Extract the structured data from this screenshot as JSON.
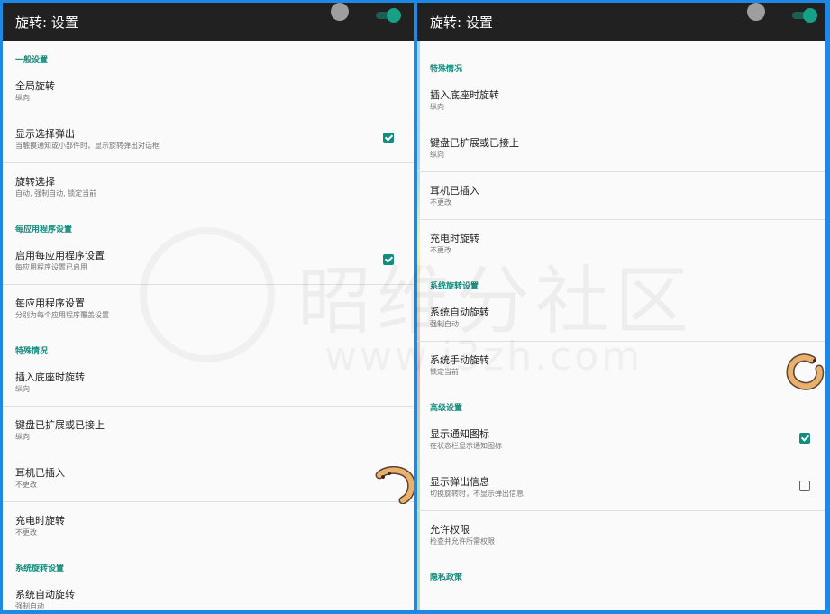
{
  "app": {
    "title": "旋转: 设置"
  },
  "left": {
    "sections": [
      {
        "header": "一般设置",
        "items": [
          {
            "title": "全局旋转",
            "subtitle": "纵向"
          },
          {
            "title": "显示选择弹出",
            "subtitle": "当触摸通知或小部件时，显示旋转弹出对话框",
            "checked": true
          },
          {
            "title": "旋转选择",
            "subtitle": "自动, 强制自动, 锁定当前"
          }
        ]
      },
      {
        "header": "每应用程序设置",
        "items": [
          {
            "title": "启用每应用程序设置",
            "subtitle": "每应用程序设置已启用",
            "checked": true
          },
          {
            "title": "每应用程序设置",
            "subtitle": "分别为每个应用程序覆盖设置"
          }
        ]
      },
      {
        "header": "特殊情况",
        "items": [
          {
            "title": "插入底座时旋转",
            "subtitle": "纵向"
          },
          {
            "title": "键盘已扩展或已接上",
            "subtitle": "纵向"
          },
          {
            "title": "耳机已插入",
            "subtitle": "不更改"
          },
          {
            "title": "充电时旋转",
            "subtitle": "不更改"
          }
        ]
      },
      {
        "header": "系统旋转设置",
        "items": [
          {
            "title": "系统自动旋转",
            "subtitle": "强制自动"
          }
        ]
      }
    ]
  },
  "right": {
    "partial_top": {
      "title": "每应用程序设置",
      "subtitle": "分别为每个应用程序覆盖设置"
    },
    "sections": [
      {
        "header": "特殊情况",
        "items": [
          {
            "title": "插入底座时旋转",
            "subtitle": "纵向"
          },
          {
            "title": "键盘已扩展或已接上",
            "subtitle": "纵向"
          },
          {
            "title": "耳机已插入",
            "subtitle": "不更改"
          },
          {
            "title": "充电时旋转",
            "subtitle": "不更改"
          }
        ]
      },
      {
        "header": "系统旋转设置",
        "items": [
          {
            "title": "系统自动旋转",
            "subtitle": "强制自动"
          },
          {
            "title": "系统手动旋转",
            "subtitle": "锁定当前"
          }
        ]
      },
      {
        "header": "高级设置",
        "items": [
          {
            "title": "显示通知图标",
            "subtitle": "在状态栏显示通知图标",
            "checked": true
          },
          {
            "title": "显示弹出信息",
            "subtitle": "切换旋转时，不显示弹出信息",
            "checked": false
          },
          {
            "title": "允许权限",
            "subtitle": "检查并允许所需权限"
          }
        ]
      },
      {
        "header": "隐私政策",
        "items": []
      }
    ]
  },
  "watermark": {
    "name": "昭维分社区",
    "url": "www.i3zh.com"
  },
  "colors": {
    "accent": "#128c7e",
    "appbar": "#212121",
    "frame": "#1e88e5",
    "background": "#fafafa"
  },
  "icons": {
    "enable_switch": "toggle-switch-icon",
    "rotate_indicator": "rotate-curl-icon"
  }
}
